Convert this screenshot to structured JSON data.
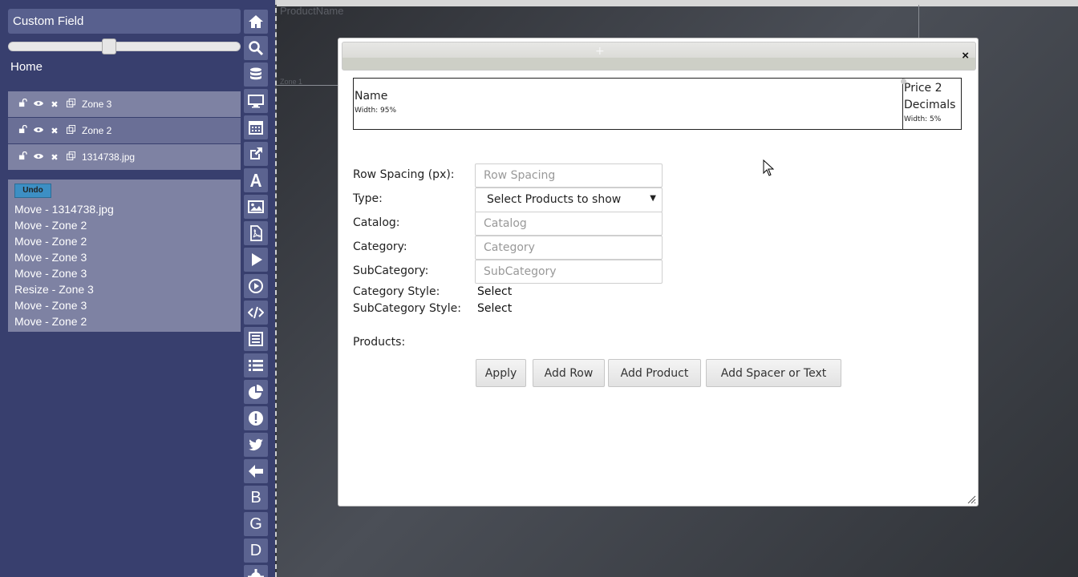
{
  "sidebar": {
    "title": "Custom Field",
    "home_label": "Home",
    "layers": [
      {
        "name": "Zone 3"
      },
      {
        "name": "Zone 2"
      },
      {
        "name": "1314738.jpg"
      }
    ],
    "undo_label": "Undo",
    "history": [
      "Move - 1314738.jpg",
      "Move - Zone 2",
      "Move - Zone 2",
      "Move - Zone 3",
      "Move - Zone 3",
      "Resize - Zone 3",
      "Move - Zone 3",
      "Move - Zone 2"
    ]
  },
  "toolbar": {
    "icons": [
      "home-icon",
      "search-icon",
      "database-icon",
      "monitor-icon",
      "calendar-icon",
      "external-link-icon",
      "text-icon",
      "image-icon",
      "pdf-icon",
      "play-icon",
      "play-circle-icon",
      "code-icon",
      "form-icon",
      "list-icon",
      "pie-chart-icon",
      "alert-icon",
      "twitter-icon",
      "back-arrow-icon",
      "b-icon",
      "g-icon",
      "d-icon",
      "gear-icon"
    ],
    "letters": {
      "b": "B",
      "g": "G",
      "d": "D"
    }
  },
  "canvas": {
    "ghost_product_name": "ProductName",
    "ghost_zone": "Zone 1"
  },
  "dialog": {
    "close_glyph": "×",
    "drag_glyph": "+",
    "columns": [
      {
        "title": "Name",
        "width_label": "Width: 95%"
      },
      {
        "title": "Price 2 Decimals",
        "width_label": "Width: 5%"
      }
    ],
    "form": {
      "row_spacing_label": "Row Spacing (px):",
      "row_spacing_placeholder": "Row Spacing",
      "type_label": "Type:",
      "type_value": "Select Products to show",
      "catalog_label": "Catalog:",
      "catalog_placeholder": "Catalog",
      "category_label": "Category:",
      "category_placeholder": "Category",
      "subcategory_label": "SubCategory:",
      "subcategory_placeholder": "SubCategory",
      "category_style_label": "Category Style:",
      "category_style_value": "Select",
      "subcategory_style_label": "SubCategory Style:",
      "subcategory_style_value": "Select",
      "products_label": "Products:"
    },
    "buttons": {
      "apply": "Apply",
      "add_row": "Add Row",
      "add_product": "Add Product",
      "add_spacer": "Add Spacer or Text"
    }
  },
  "colors": {
    "sidebar_bg": "#383f6e",
    "sidebar_item_light": "#7e82a3",
    "toolbar_button": "#5b6390",
    "undo_button": "#3d8fc4"
  }
}
